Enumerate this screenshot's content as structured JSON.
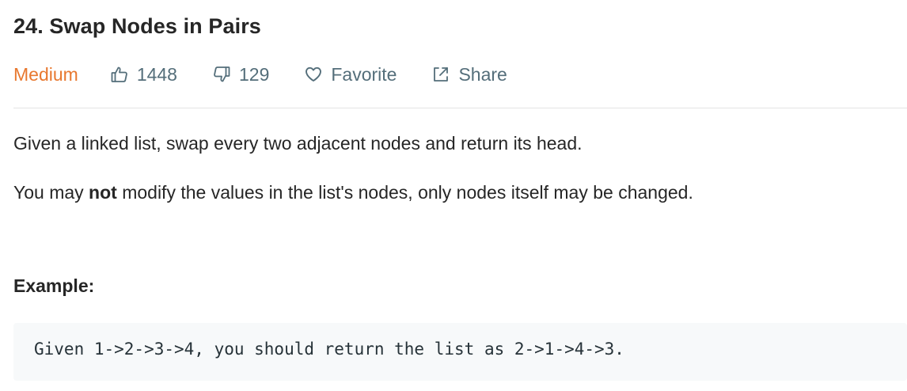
{
  "problem": {
    "title": "24. Swap Nodes in Pairs",
    "difficulty": "Medium",
    "likes": "1448",
    "dislikes": "129",
    "favorite_label": "Favorite",
    "share_label": "Share"
  },
  "description": {
    "line1": "Given a linked list, swap every two adjacent nodes and return its head.",
    "line2_prefix": "You may ",
    "line2_bold": "not",
    "line2_suffix": " modify the values in the list's nodes, only nodes itself may be changed."
  },
  "example": {
    "label": "Example:",
    "code": "Given 1->2->3->4, you should return the list as 2->1->4->3."
  },
  "colors": {
    "difficulty_medium": "#e8782f",
    "meta_text": "#546e7a",
    "code_background": "#f7f9fa"
  },
  "icons": {
    "likes": "thumbs-up-icon",
    "dislikes": "thumbs-down-icon",
    "favorite": "heart-icon",
    "share": "share-icon"
  }
}
